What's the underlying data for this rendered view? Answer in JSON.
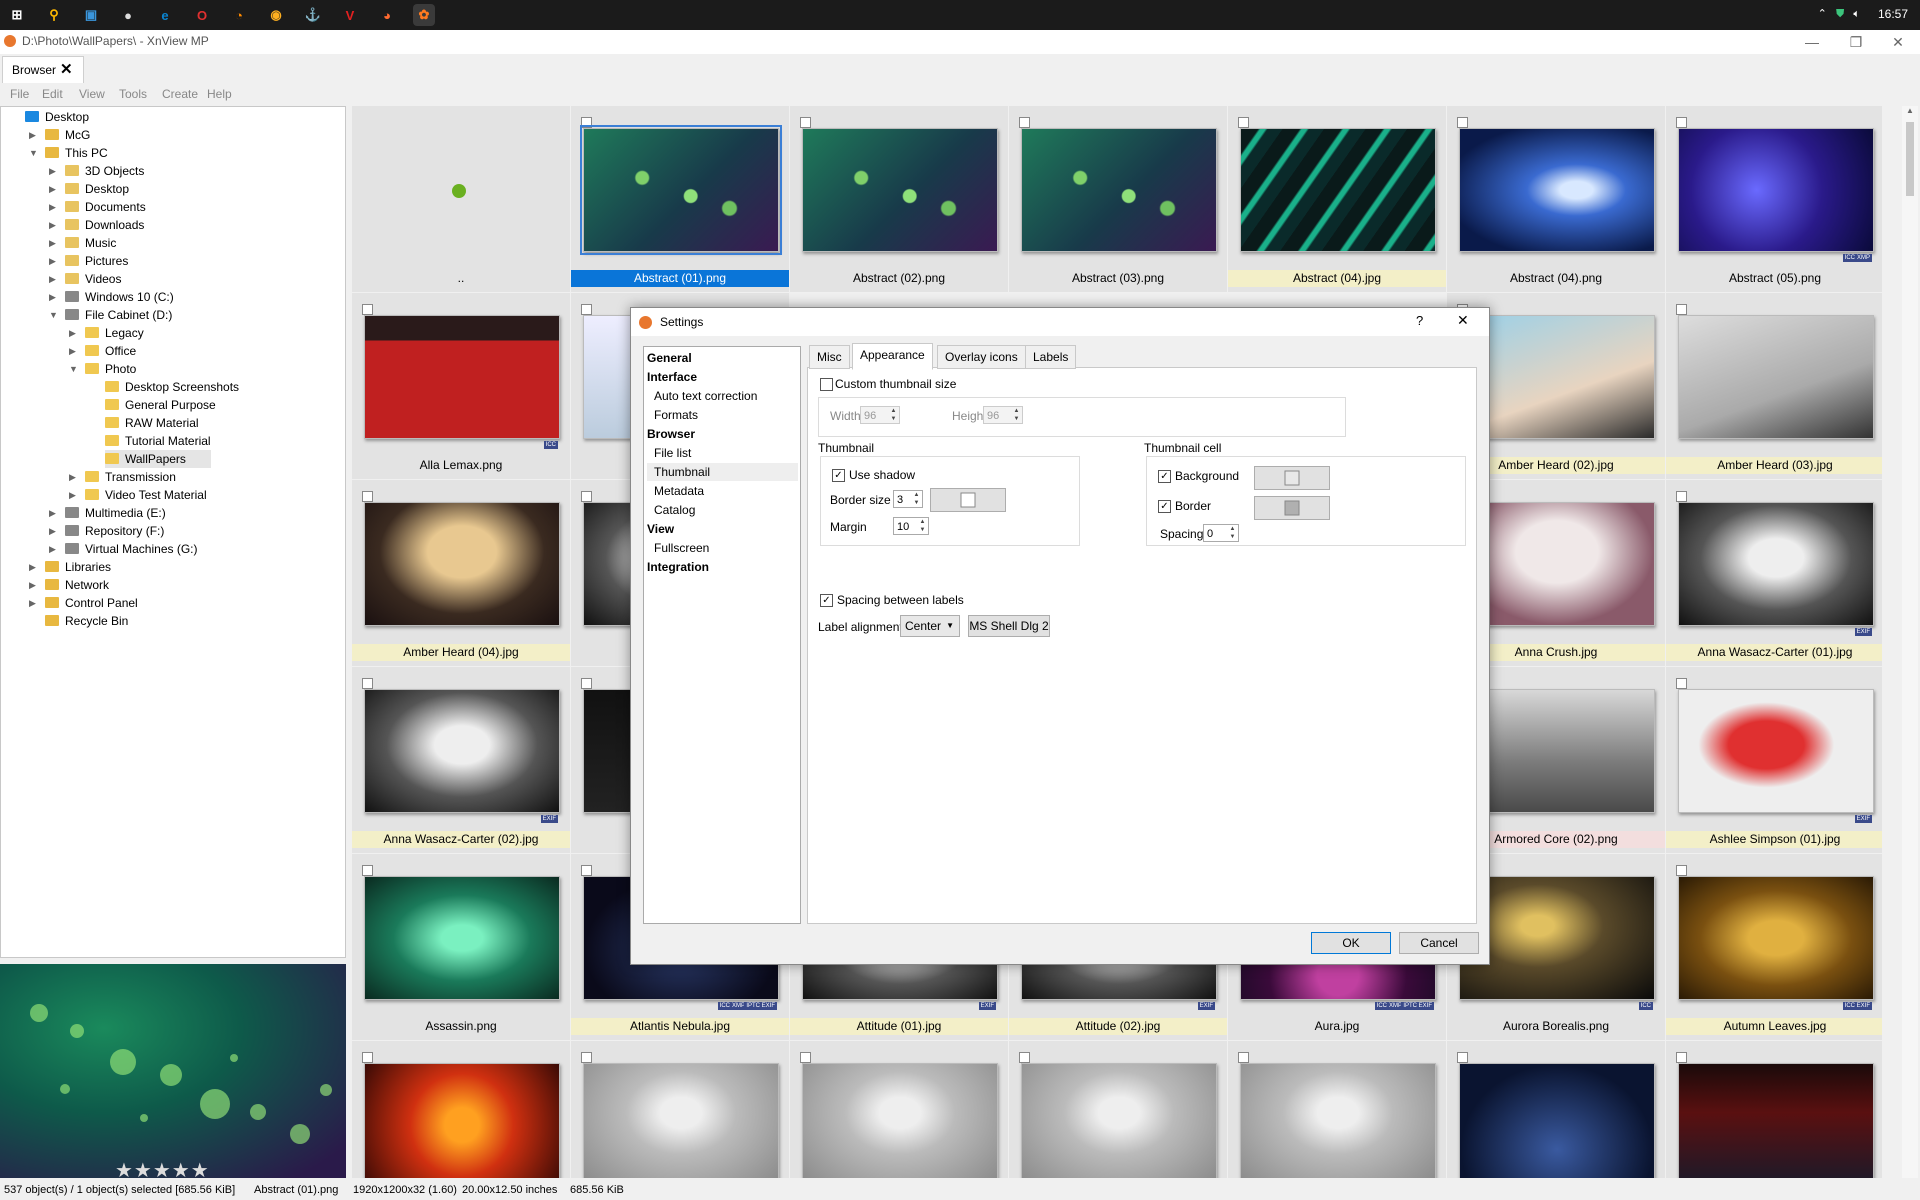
{
  "taskbar": {
    "clock": "16:57",
    "icons": [
      "windows-start-icon",
      "search-icon",
      "task-view-icon",
      "app-icon",
      "edge-icon",
      "opera-icon",
      "firefox-icon",
      "chrome-icon",
      "app-icon",
      "vivaldi-icon",
      "firefox-dev-icon",
      "xnview-icon"
    ]
  },
  "window": {
    "title": "D:\\Photo\\WallPapers\\ - XnView MP",
    "tab_label": "Browser"
  },
  "menu": [
    "File",
    "Edit",
    "View",
    "Tools",
    "Create",
    "Help"
  ],
  "tree": [
    {
      "label": "Desktop",
      "depth": 0,
      "expander": ""
    },
    {
      "label": "McG",
      "depth": 1,
      "expander": "▶"
    },
    {
      "label": "This PC",
      "depth": 1,
      "expander": "▼"
    },
    {
      "label": "3D Objects",
      "depth": 2,
      "expander": "▶"
    },
    {
      "label": "Desktop",
      "depth": 2,
      "expander": "▶"
    },
    {
      "label": "Documents",
      "depth": 2,
      "expander": "▶"
    },
    {
      "label": "Downloads",
      "depth": 2,
      "expander": "▶"
    },
    {
      "label": "Music",
      "depth": 2,
      "expander": "▶"
    },
    {
      "label": "Pictures",
      "depth": 2,
      "expander": "▶"
    },
    {
      "label": "Videos",
      "depth": 2,
      "expander": "▶"
    },
    {
      "label": "Windows 10 (C:)",
      "depth": 2,
      "expander": "▶"
    },
    {
      "label": "File Cabinet (D:)",
      "depth": 2,
      "expander": "▼"
    },
    {
      "label": "Legacy",
      "depth": 3,
      "expander": "▶"
    },
    {
      "label": "Office",
      "depth": 3,
      "expander": "▶"
    },
    {
      "label": "Photo",
      "depth": 3,
      "expander": "▼"
    },
    {
      "label": "Desktop Screenshots",
      "depth": 4,
      "expander": ""
    },
    {
      "label": "General Purpose",
      "depth": 4,
      "expander": ""
    },
    {
      "label": "RAW Material",
      "depth": 4,
      "expander": ""
    },
    {
      "label": "Tutorial Material",
      "depth": 4,
      "expander": ""
    },
    {
      "label": "WallPapers",
      "depth": 4,
      "expander": "",
      "selected": true
    },
    {
      "label": "Transmission",
      "depth": 3,
      "expander": "▶"
    },
    {
      "label": "Video Test Material",
      "depth": 3,
      "expander": "▶"
    },
    {
      "label": "Multimedia (E:)",
      "depth": 2,
      "expander": "▶"
    },
    {
      "label": "Repository (F:)",
      "depth": 2,
      "expander": "▶"
    },
    {
      "label": "Virtual Machines (G:)",
      "depth": 2,
      "expander": "▶"
    },
    {
      "label": "Libraries",
      "depth": 1,
      "expander": "▶"
    },
    {
      "label": "Network",
      "depth": 1,
      "expander": "▶"
    },
    {
      "label": "Control Panel",
      "depth": 1,
      "expander": "▶"
    },
    {
      "label": "Recycle Bin",
      "depth": 1,
      "expander": ""
    }
  ],
  "grid": {
    "rows": [
      [
        {
          "label": "..",
          "kind": "parent"
        },
        {
          "label": "Abstract (01).png",
          "kind": "bokeh",
          "selected": true
        },
        {
          "label": "Abstract (02).png",
          "kind": "bokeh"
        },
        {
          "label": "Abstract (03).png",
          "kind": "bokeh"
        },
        {
          "label": "Abstract (04).jpg",
          "kind": "stripes",
          "highlight": true
        },
        {
          "label": "Abstract (04).png",
          "kind": "blue"
        },
        {
          "label": "Abstract (05).png",
          "kind": "space",
          "badges": [
            "ICC",
            "XMP"
          ]
        }
      ],
      [
        {
          "label": "Alla Lemax.png",
          "kind": "red",
          "badges": [
            "ICC"
          ]
        },
        {
          "label": "",
          "kind": "photo"
        },
        {
          "label": "",
          "kind": "hidden"
        },
        {
          "label": "",
          "kind": "hidden"
        },
        {
          "label": "",
          "kind": "hidden"
        },
        {
          "label": "Amber Heard (02).jpg",
          "kind": "beach",
          "highlight": true
        },
        {
          "label": "Amber Heard (03).jpg",
          "kind": "beachbw",
          "highlight": true
        }
      ],
      [
        {
          "label": "Amber Heard (04).jpg",
          "kind": "portrait",
          "highlight": true
        },
        {
          "label": "",
          "kind": "bw"
        },
        {
          "label": "",
          "kind": "hidden"
        },
        {
          "label": "",
          "kind": "hidden"
        },
        {
          "label": "",
          "kind": "hidden"
        },
        {
          "label": "Anna Crush.jpg",
          "kind": "pink",
          "highlight": true
        },
        {
          "label": "Anna Wasacz-Carter (01).jpg",
          "kind": "bw",
          "highlight": true,
          "badges": [
            "EXIF"
          ]
        }
      ],
      [
        {
          "label": "Anna Wasacz-Carter (02).jpg",
          "kind": "bw",
          "highlight": true,
          "badges": [
            "EXIF"
          ]
        },
        {
          "label": "Ann",
          "kind": "dark"
        },
        {
          "label": "",
          "kind": "hidden"
        },
        {
          "label": "",
          "kind": "hidden"
        },
        {
          "label": "",
          "kind": "hidden"
        },
        {
          "label": "Armored Core (02).png",
          "kind": "grey",
          "pink": true
        },
        {
          "label": "Ashlee Simpson (01).jpg",
          "kind": "redgirl",
          "highlight": true,
          "badges": [
            "EXIF"
          ]
        }
      ],
      [
        {
          "label": "Assassin.png",
          "kind": "green"
        },
        {
          "label": "Atlantis Nebula.jpg",
          "kind": "navy",
          "highlight": true,
          "badges": [
            "ICC",
            "XMP",
            "IPTC",
            "EXIF"
          ]
        },
        {
          "label": "Attitude (01).jpg",
          "kind": "bw",
          "highlight": true,
          "badges": [
            "EXIF"
          ]
        },
        {
          "label": "Attitude (02).jpg",
          "kind": "bw",
          "highlight": true,
          "badges": [
            "EXIF"
          ]
        },
        {
          "label": "Aura.jpg",
          "kind": "aura",
          "badges": [
            "ICC",
            "XMP",
            "IPTC",
            "EXIF"
          ]
        },
        {
          "label": "Aurora Borealis.png",
          "kind": "aurora",
          "badges": [
            "ICC"
          ]
        },
        {
          "label": "Autumn Leaves.jpg",
          "kind": "autumn",
          "highlight": true,
          "badges": [
            "ICC",
            "EXIF"
          ]
        }
      ],
      [
        {
          "label": "",
          "kind": "flower"
        },
        {
          "label": "",
          "kind": "dancer"
        },
        {
          "label": "",
          "kind": "dancer"
        },
        {
          "label": "",
          "kind": "dancer"
        },
        {
          "label": "",
          "kind": "dancer"
        },
        {
          "label": "",
          "kind": "night"
        },
        {
          "label": "",
          "kind": "neon"
        }
      ]
    ]
  },
  "statusbar": {
    "count": "537 object(s) / 1 object(s) selected [685.56 KiB]",
    "file": "Abstract (01).png",
    "dims": "1920x1200x32 (1.60)",
    "inches": "20.00x12.50 inches",
    "size": "685.56 KiB"
  },
  "dialog": {
    "title": "Settings",
    "help": "?",
    "close": "✕",
    "categories": [
      {
        "label": "General",
        "type": "h"
      },
      {
        "label": "Interface",
        "type": "h"
      },
      {
        "label": "Auto text correction",
        "type": "sub"
      },
      {
        "label": "Formats",
        "type": "sub"
      },
      {
        "label": "Browser",
        "type": "h"
      },
      {
        "label": "File list",
        "type": "sub"
      },
      {
        "label": "Thumbnail",
        "type": "sub",
        "active": true
      },
      {
        "label": "Metadata",
        "type": "sub"
      },
      {
        "label": "Catalog",
        "type": "sub"
      },
      {
        "label": "View",
        "type": "h"
      },
      {
        "label": "Fullscreen",
        "type": "sub"
      },
      {
        "label": "Integration",
        "type": "h"
      }
    ],
    "tabs": [
      "Misc",
      "Appearance",
      "Overlay icons",
      "Labels"
    ],
    "active_tab": "Appearance",
    "custom_size_label": "Custom thumbnail size",
    "custom_size_checked": false,
    "width_label": "Width",
    "width_value": "96",
    "height_label": "Height",
    "height_value": "96",
    "thumbnail_group": "Thumbnail",
    "use_shadow_label": "Use shadow",
    "use_shadow_checked": true,
    "border_size_label": "Border size",
    "border_size_value": "3",
    "margin_label": "Margin",
    "margin_value": "10",
    "cell_group": "Thumbnail cell",
    "background_label": "Background",
    "background_checked": true,
    "background_color": "#e8e8e8",
    "border_label": "Border",
    "border_checked": true,
    "border_color": "#b0b0b0",
    "thumb_border_color": "#ffffff",
    "spacing_label": "Spacing",
    "spacing_value": "0",
    "spacing_labels_label": "Spacing between labels",
    "spacing_labels_checked": true,
    "label_alignment_label": "Label alignment",
    "label_alignment_value": "Center",
    "font_button": "MS Shell Dlg 2",
    "ok": "OK",
    "cancel": "Cancel"
  },
  "colors": {
    "selection": "#0a75d8",
    "highlight_label": "#f3efc8",
    "pink_label": "#f3dede"
  }
}
